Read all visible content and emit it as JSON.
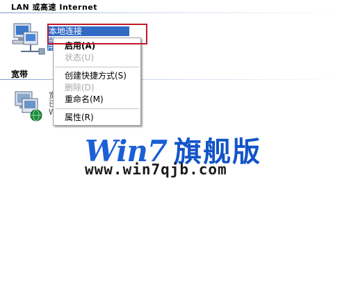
{
  "lan_section": {
    "header": "LAN 或高速 Internet",
    "connection_name": "本地连接",
    "connection_subtext": "禁用"
  },
  "broadband_section": {
    "header": "宽带",
    "connection_name_partial": "宽",
    "subtext_line1": "已",
    "subtext_line2": "W"
  },
  "context_menu": {
    "items": [
      {
        "label": "启用(A)",
        "enabled": true,
        "default": true
      },
      {
        "label": "状态(U)",
        "enabled": false
      },
      {
        "label": "创建快捷方式(S)",
        "enabled": true
      },
      {
        "label": "删除(D)",
        "enabled": false
      },
      {
        "label": "重命名(M)",
        "enabled": true
      },
      {
        "label": "属性(R)",
        "enabled": true
      }
    ]
  },
  "watermark": {
    "brand_latin": "Win7",
    "brand_cjk": "旗舰版",
    "url": "www.win7qjb.com"
  },
  "colors": {
    "selection": "#316ac5",
    "highlight_border": "#c0172a",
    "watermark_blue": "#1c5fd6"
  }
}
